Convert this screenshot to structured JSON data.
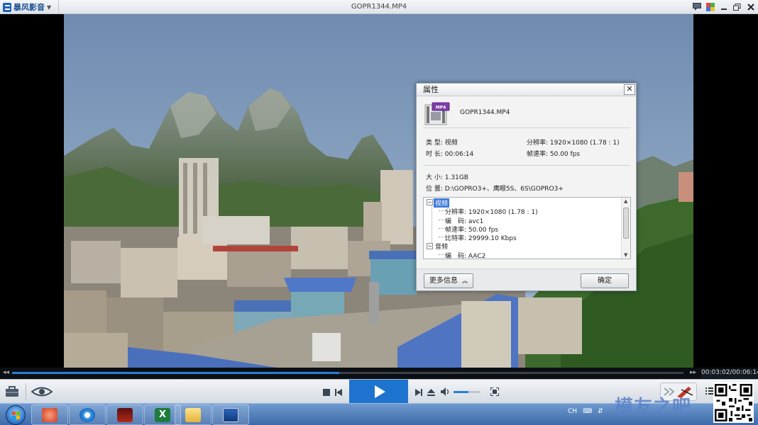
{
  "titlebar": {
    "app_name": "暴风影音",
    "app_menu_icon": "chevron-down-icon",
    "title": "GOPR1344.MP4",
    "buttons": [
      "chat-icon",
      "skin-icon",
      "minimize-icon",
      "restore-icon",
      "close-icon"
    ]
  },
  "dialog": {
    "title": "属性",
    "close": "✕",
    "file_name": "GOPR1344.MP4",
    "file_icon_label": "MP4",
    "fields": {
      "type_label": "类 型:",
      "type_value": "视频",
      "duration_label": "时 长:",
      "duration_value": "00:06:14",
      "resolution_label": "分辨率:",
      "resolution_value": "1920×1080 (1.78 : 1)",
      "framerate_label": "帧速率:",
      "framerate_value": "50.00 fps",
      "size_label": "大 小:",
      "size_value": "1.31GB",
      "location_label": "位 置:",
      "location_value": "D:\\GOPRO3+、鹰眼5S、6S\\GOPRO3+"
    },
    "tree": {
      "video_node": "视频",
      "video_items": [
        "分辨率: 1920×1080 (1.78 : 1)",
        "编　码: avc1",
        "帧速率: 50.00 fps",
        "比特率: 29999.10 Kbps"
      ],
      "audio_node": "音频",
      "audio_items": [
        "编　码: AAC2"
      ]
    },
    "more_button": "更多信息",
    "ok_button": "确定"
  },
  "seekbar": {
    "time": "00:03:02/00:06:14",
    "progress": 0.487
  },
  "controls": {
    "left_icons": [
      "toolbox-icon",
      "eye-icon"
    ],
    "center_icons": [
      "stop-icon",
      "previous-icon",
      "play-icon",
      "next-icon",
      "eject-icon",
      "volume-icon",
      "fullscreen-icon"
    ],
    "volume_level": 0.55,
    "right_icons": [
      "fast-forward-icon",
      "menu-icon"
    ]
  },
  "taskbar": {
    "apps": [
      "start-button",
      "ccleaner-icon",
      "baofeng-icon",
      "movie-icon",
      "excel-icon",
      "explorer-icon",
      "player-icon"
    ],
    "tray_lang": "CH"
  },
  "watermark": "模友之吧",
  "colors": {
    "accent": "#1e73cf",
    "seek_fill": "#2a7fd6",
    "selection": "#3c78d8"
  }
}
